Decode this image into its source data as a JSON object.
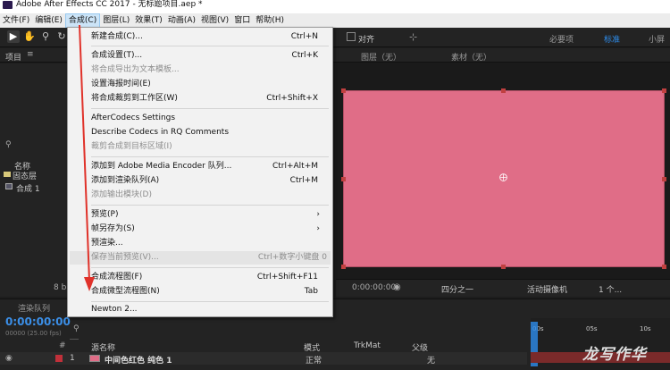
{
  "window": {
    "title": "Adobe After Effects CC 2017 - 无标题项目.aep *"
  },
  "menubar": [
    "文件(F)",
    "编辑(E)",
    "合成(C)",
    "图层(L)",
    "效果(T)",
    "动画(A)",
    "视图(V)",
    "窗口",
    "帮助(H)"
  ],
  "toolbar": {
    "align_label": "对齐",
    "ws_essentials": "必要项",
    "ws_standard": "标准",
    "ws_small": "小屏"
  },
  "project": {
    "tab": "项目",
    "col_name": "名称",
    "folder": "固态层",
    "comp": "合成 1",
    "bpc": "8 b"
  },
  "viewer": {
    "layer_tab": "图层（无）",
    "footage_tab": "素材（无）",
    "timecode": "0:00:00:00",
    "resolution": "四分之一",
    "camera": "活动摄像机",
    "views": "1 个..."
  },
  "timeline": {
    "render_queue": "渲染队列",
    "current_time": "0:00:00:00",
    "fps": "00000 (25.00 fps)",
    "col_source": "源名称",
    "col_mode": "模式",
    "col_trkmat": "TrkMat",
    "col_parent": "父级",
    "layer_num": "1",
    "layer_name": "中间色红色 纯色 1",
    "layer_mode": "正常",
    "layer_parent": "无",
    "ruler": [
      "00s",
      "05s",
      "10s"
    ]
  },
  "menu": {
    "items": [
      {
        "label": "新建合成(C)...",
        "shortcut": "Ctrl+N",
        "disabled": false
      },
      {
        "label": "合成设置(T)...",
        "shortcut": "Ctrl+K",
        "disabled": false
      },
      {
        "label": "将合成导出为文本模板...",
        "shortcut": "",
        "disabled": true
      },
      {
        "label": "设置海报时间(E)",
        "shortcut": "",
        "disabled": false
      },
      {
        "label": "将合成裁剪到工作区(W)",
        "shortcut": "Ctrl+Shift+X",
        "disabled": false
      },
      {
        "label": "AfterCodecs Settings",
        "shortcut": "",
        "disabled": false
      },
      {
        "label": "Describe Codecs in RQ Comments",
        "shortcut": "",
        "disabled": false
      },
      {
        "label": "裁剪合成到目标区域(I)",
        "shortcut": "",
        "disabled": true
      },
      {
        "label": "添加到 Adobe Media Encoder 队列...",
        "shortcut": "Ctrl+Alt+M",
        "disabled": false
      },
      {
        "label": "添加到渲染队列(A)",
        "shortcut": "Ctrl+M",
        "disabled": false
      },
      {
        "label": "添加输出模块(D)",
        "shortcut": "",
        "disabled": true
      },
      {
        "label": "预览(P)",
        "shortcut": "",
        "disabled": false,
        "submenu": true
      },
      {
        "label": "帧另存为(S)",
        "shortcut": "",
        "disabled": false,
        "submenu": true
      },
      {
        "label": "预渲染...",
        "shortcut": "",
        "disabled": false
      },
      {
        "label": "保存当前预览(V)...",
        "shortcut": "Ctrl+数字小键盘 0",
        "disabled": true
      },
      {
        "label": "合成流程图(F)",
        "shortcut": "Ctrl+Shift+F11",
        "disabled": false
      },
      {
        "label": "合成微型流程图(N)",
        "shortcut": "Tab",
        "disabled": false
      },
      {
        "label": "Newton 2...",
        "shortcut": "",
        "disabled": false
      }
    ]
  },
  "watermark": "龙写作华",
  "colors": {
    "solid": "#e06d87",
    "accent": "#2d8ceb",
    "arrow": "#e0322a"
  }
}
